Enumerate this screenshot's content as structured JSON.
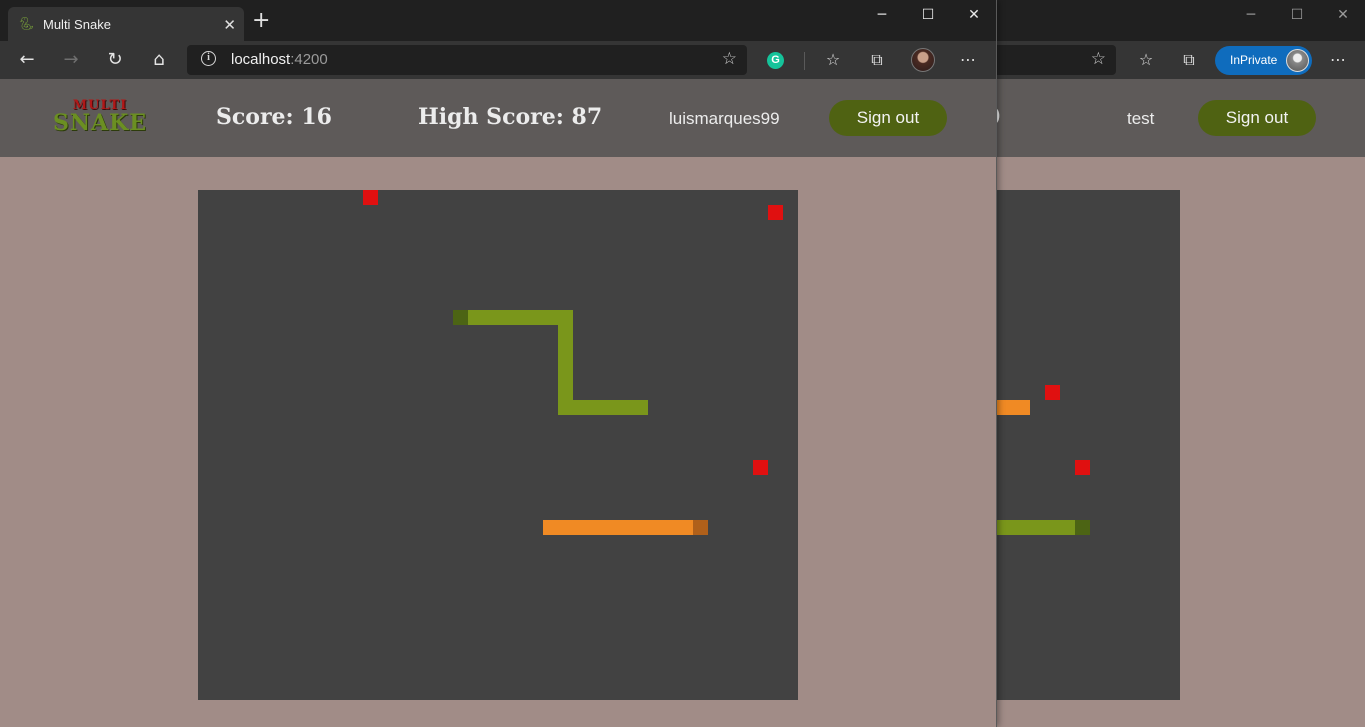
{
  "browser": {
    "tab_title": "Multi Snake",
    "tab_icon": "snake-icon",
    "new_tab": "+",
    "address_host": "localhost",
    "address_port": ":4200",
    "window_controls": [
      "─",
      "☐",
      "✕"
    ],
    "inprivate_label": "InPrivate"
  },
  "front": {
    "logo_top": "MULTI",
    "logo_bottom": "SNAKE",
    "score_text": "Score: 16",
    "high_score_text": "High Score: 87",
    "username": "luismarques99",
    "signout_label": "Sign out"
  },
  "back": {
    "partial_score_fragment": "0",
    "username": "test",
    "signout_label": "Sign out"
  },
  "colors": {
    "board": "#424242",
    "page_bg": "#a18c87",
    "header_bg": "#5e5a59",
    "signout_bg": "#4f6212",
    "food": "#e01010",
    "green_snake": "#7a961b",
    "green_snake_head": "#4c6414",
    "orange_snake": "#f08a24",
    "orange_snake_head": "#b0601a"
  }
}
